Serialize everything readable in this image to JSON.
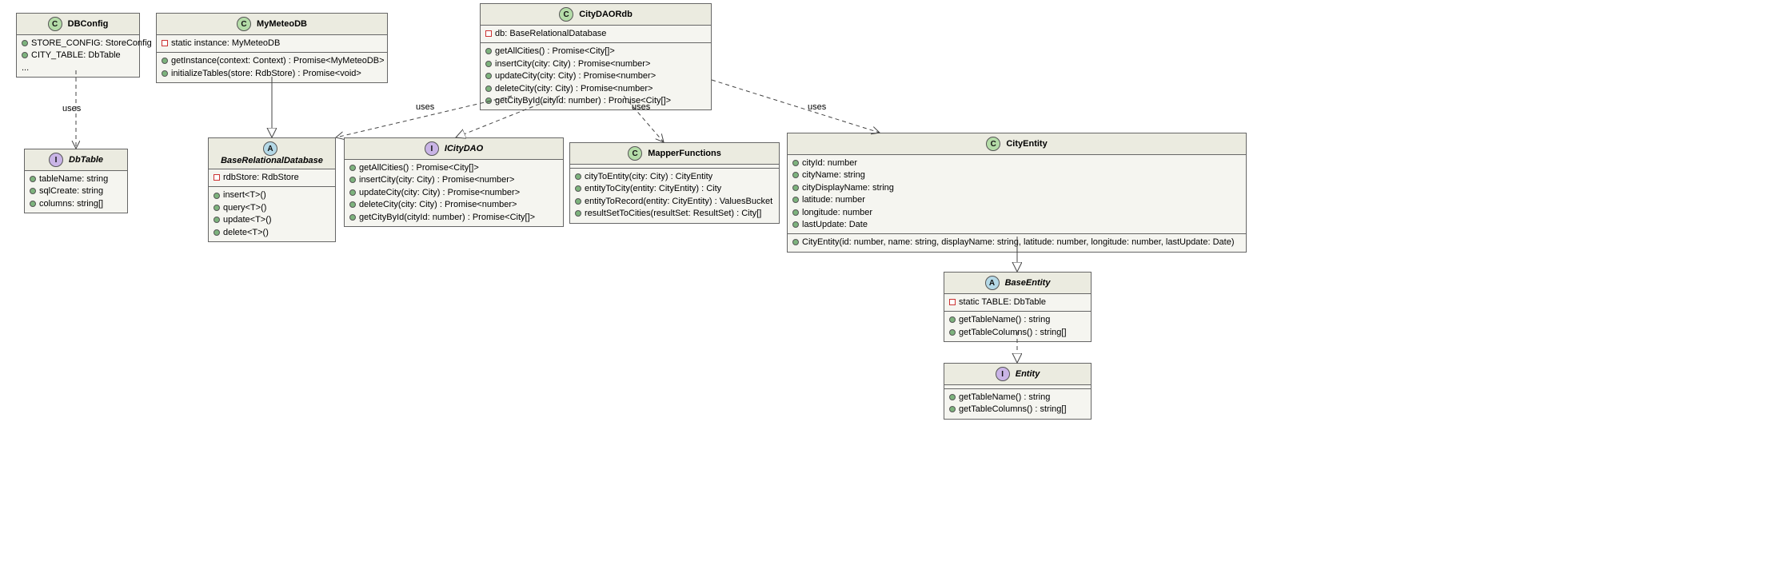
{
  "classes": {
    "DBConfig": {
      "stereotype": "C",
      "name": "DBConfig",
      "sections": [
        [
          {
            "vis": "public",
            "text": "STORE_CONFIG: StoreConfig"
          },
          {
            "vis": "public",
            "text": "CITY_TABLE: DbTable"
          },
          {
            "vis": null,
            "text": "..."
          }
        ]
      ]
    },
    "MyMeteoDB": {
      "stereotype": "C",
      "name": "MyMeteoDB",
      "sections": [
        [
          {
            "vis": "private",
            "text": "static instance: MyMeteoDB"
          }
        ],
        [
          {
            "vis": "public",
            "text": "getInstance(context: Context) : Promise<MyMeteoDB>"
          },
          {
            "vis": "public",
            "text": "initializeTables(store: RdbStore) : Promise<void>"
          }
        ]
      ]
    },
    "CityDAORdb": {
      "stereotype": "C",
      "name": "CityDAORdb",
      "sections": [
        [
          {
            "vis": "private",
            "text": "db: BaseRelationalDatabase"
          }
        ],
        [
          {
            "vis": "public",
            "text": "getAllCities() : Promise<City[]>"
          },
          {
            "vis": "public",
            "text": "insertCity(city: City) : Promise<number>"
          },
          {
            "vis": "public",
            "text": "updateCity(city: City) : Promise<number>"
          },
          {
            "vis": "public",
            "text": "deleteCity(city: City) : Promise<number>"
          },
          {
            "vis": "public",
            "text": "getCityById(cityId: number) : Promise<City[]>"
          }
        ]
      ]
    },
    "DbTable": {
      "stereotype": "I",
      "name": "DbTable",
      "sections": [
        [
          {
            "vis": "public",
            "text": "tableName: string"
          },
          {
            "vis": "public",
            "text": "sqlCreate: string"
          },
          {
            "vis": "public",
            "text": "columns: string[]"
          }
        ]
      ]
    },
    "BaseRelationalDatabase": {
      "stereotype": "A",
      "abstract": true,
      "name": "BaseRelationalDatabase",
      "sections": [
        [
          {
            "vis": "private",
            "text": "rdbStore: RdbStore"
          }
        ],
        [
          {
            "vis": "public",
            "text": "insert<T>()"
          },
          {
            "vis": "public",
            "text": "query<T>()"
          },
          {
            "vis": "public",
            "text": "update<T>()"
          },
          {
            "vis": "public",
            "text": "delete<T>()"
          }
        ]
      ]
    },
    "ICityDAO": {
      "stereotype": "I",
      "name": "ICityDAO",
      "sections": [
        [
          {
            "vis": "public",
            "text": "getAllCities() : Promise<City[]>"
          },
          {
            "vis": "public",
            "text": "insertCity(city: City) : Promise<number>"
          },
          {
            "vis": "public",
            "text": "updateCity(city: City) : Promise<number>"
          },
          {
            "vis": "public",
            "text": "deleteCity(city: City) : Promise<number>"
          },
          {
            "vis": "public",
            "text": "getCityById(cityId: number) : Promise<City[]>"
          }
        ]
      ]
    },
    "MapperFunctions": {
      "stereotype": "C",
      "name": "MapperFunctions",
      "sections": [
        [
          {
            "vis": "public",
            "text": "cityToEntity(city: City) : CityEntity"
          },
          {
            "vis": "public",
            "text": "entityToCity(entity: CityEntity) : City"
          },
          {
            "vis": "public",
            "text": "entityToRecord(entity: CityEntity) : ValuesBucket"
          },
          {
            "vis": "public",
            "text": "resultSetToCities(resultSet: ResultSet) : City[]"
          }
        ]
      ]
    },
    "CityEntity": {
      "stereotype": "C",
      "name": "CityEntity",
      "sections": [
        [
          {
            "vis": "public",
            "text": "cityId: number"
          },
          {
            "vis": "public",
            "text": "cityName: string"
          },
          {
            "vis": "public",
            "text": "cityDisplayName: string"
          },
          {
            "vis": "public",
            "text": "latitude: number"
          },
          {
            "vis": "public",
            "text": "longitude: number"
          },
          {
            "vis": "public",
            "text": "lastUpdate: Date"
          }
        ],
        [
          {
            "vis": "public",
            "text": "CityEntity(id: number, name: string, displayName: string, latitude: number, longitude: number, lastUpdate: Date)"
          }
        ]
      ]
    },
    "BaseEntity": {
      "stereotype": "A",
      "abstract": true,
      "name": "BaseEntity",
      "sections": [
        [
          {
            "vis": "private",
            "text": "static TABLE: DbTable"
          }
        ],
        [
          {
            "vis": "public",
            "text": "getTableName() : string"
          },
          {
            "vis": "public",
            "text": "getTableColumns() : string[]"
          }
        ]
      ]
    },
    "Entity": {
      "stereotype": "I",
      "name": "Entity",
      "sections": [
        [
          {
            "vis": "public",
            "text": "getTableName() : string"
          },
          {
            "vis": "public",
            "text": "getTableColumns() : string[]"
          }
        ]
      ]
    }
  },
  "labels": {
    "uses1": "uses",
    "uses2": "uses",
    "uses3": "uses",
    "uses4": "uses"
  }
}
